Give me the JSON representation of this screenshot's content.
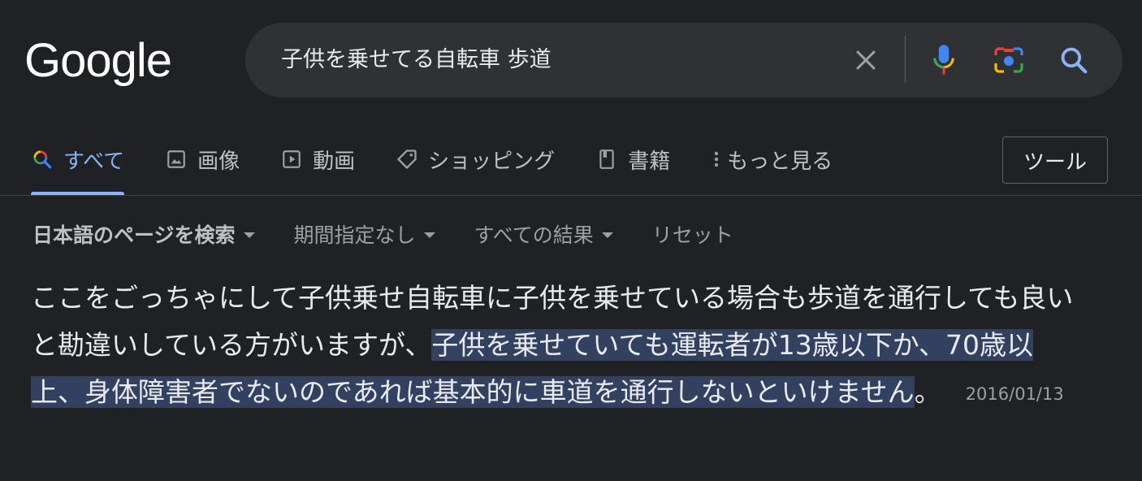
{
  "header": {
    "logo": "Google",
    "search": {
      "query": "子供を乗せてる自転車 歩道"
    }
  },
  "tabs": [
    {
      "label": "すべて",
      "icon": "search-icon",
      "active": true
    },
    {
      "label": "画像",
      "icon": "image-icon"
    },
    {
      "label": "動画",
      "icon": "video-icon"
    },
    {
      "label": "ショッピング",
      "icon": "tag-icon"
    },
    {
      "label": "書籍",
      "icon": "book-icon"
    },
    {
      "label": "もっと見る",
      "icon": "more-vert-icon"
    }
  ],
  "tools_label": "ツール",
  "filters": {
    "language": "日本語のページを検索",
    "period": "期間指定なし",
    "results": "すべての結果",
    "reset": "リセット"
  },
  "snippet": {
    "text_plain": "ここをごっちゃにして子供乗せ自転車に子供を乗せている場合も歩道を通行しても良いと勘違いしている方がいますが、",
    "text_highlight": "子供を乗せていても運転者が13歳以下か、70歳以上、身体障害者でないのであれば基本的に車道を通行しないといけません",
    "text_end": "。",
    "date": "2016/01/13"
  },
  "colors": {
    "background": "#202124",
    "accent": "#8ab4f8",
    "highlight": "#334161"
  }
}
